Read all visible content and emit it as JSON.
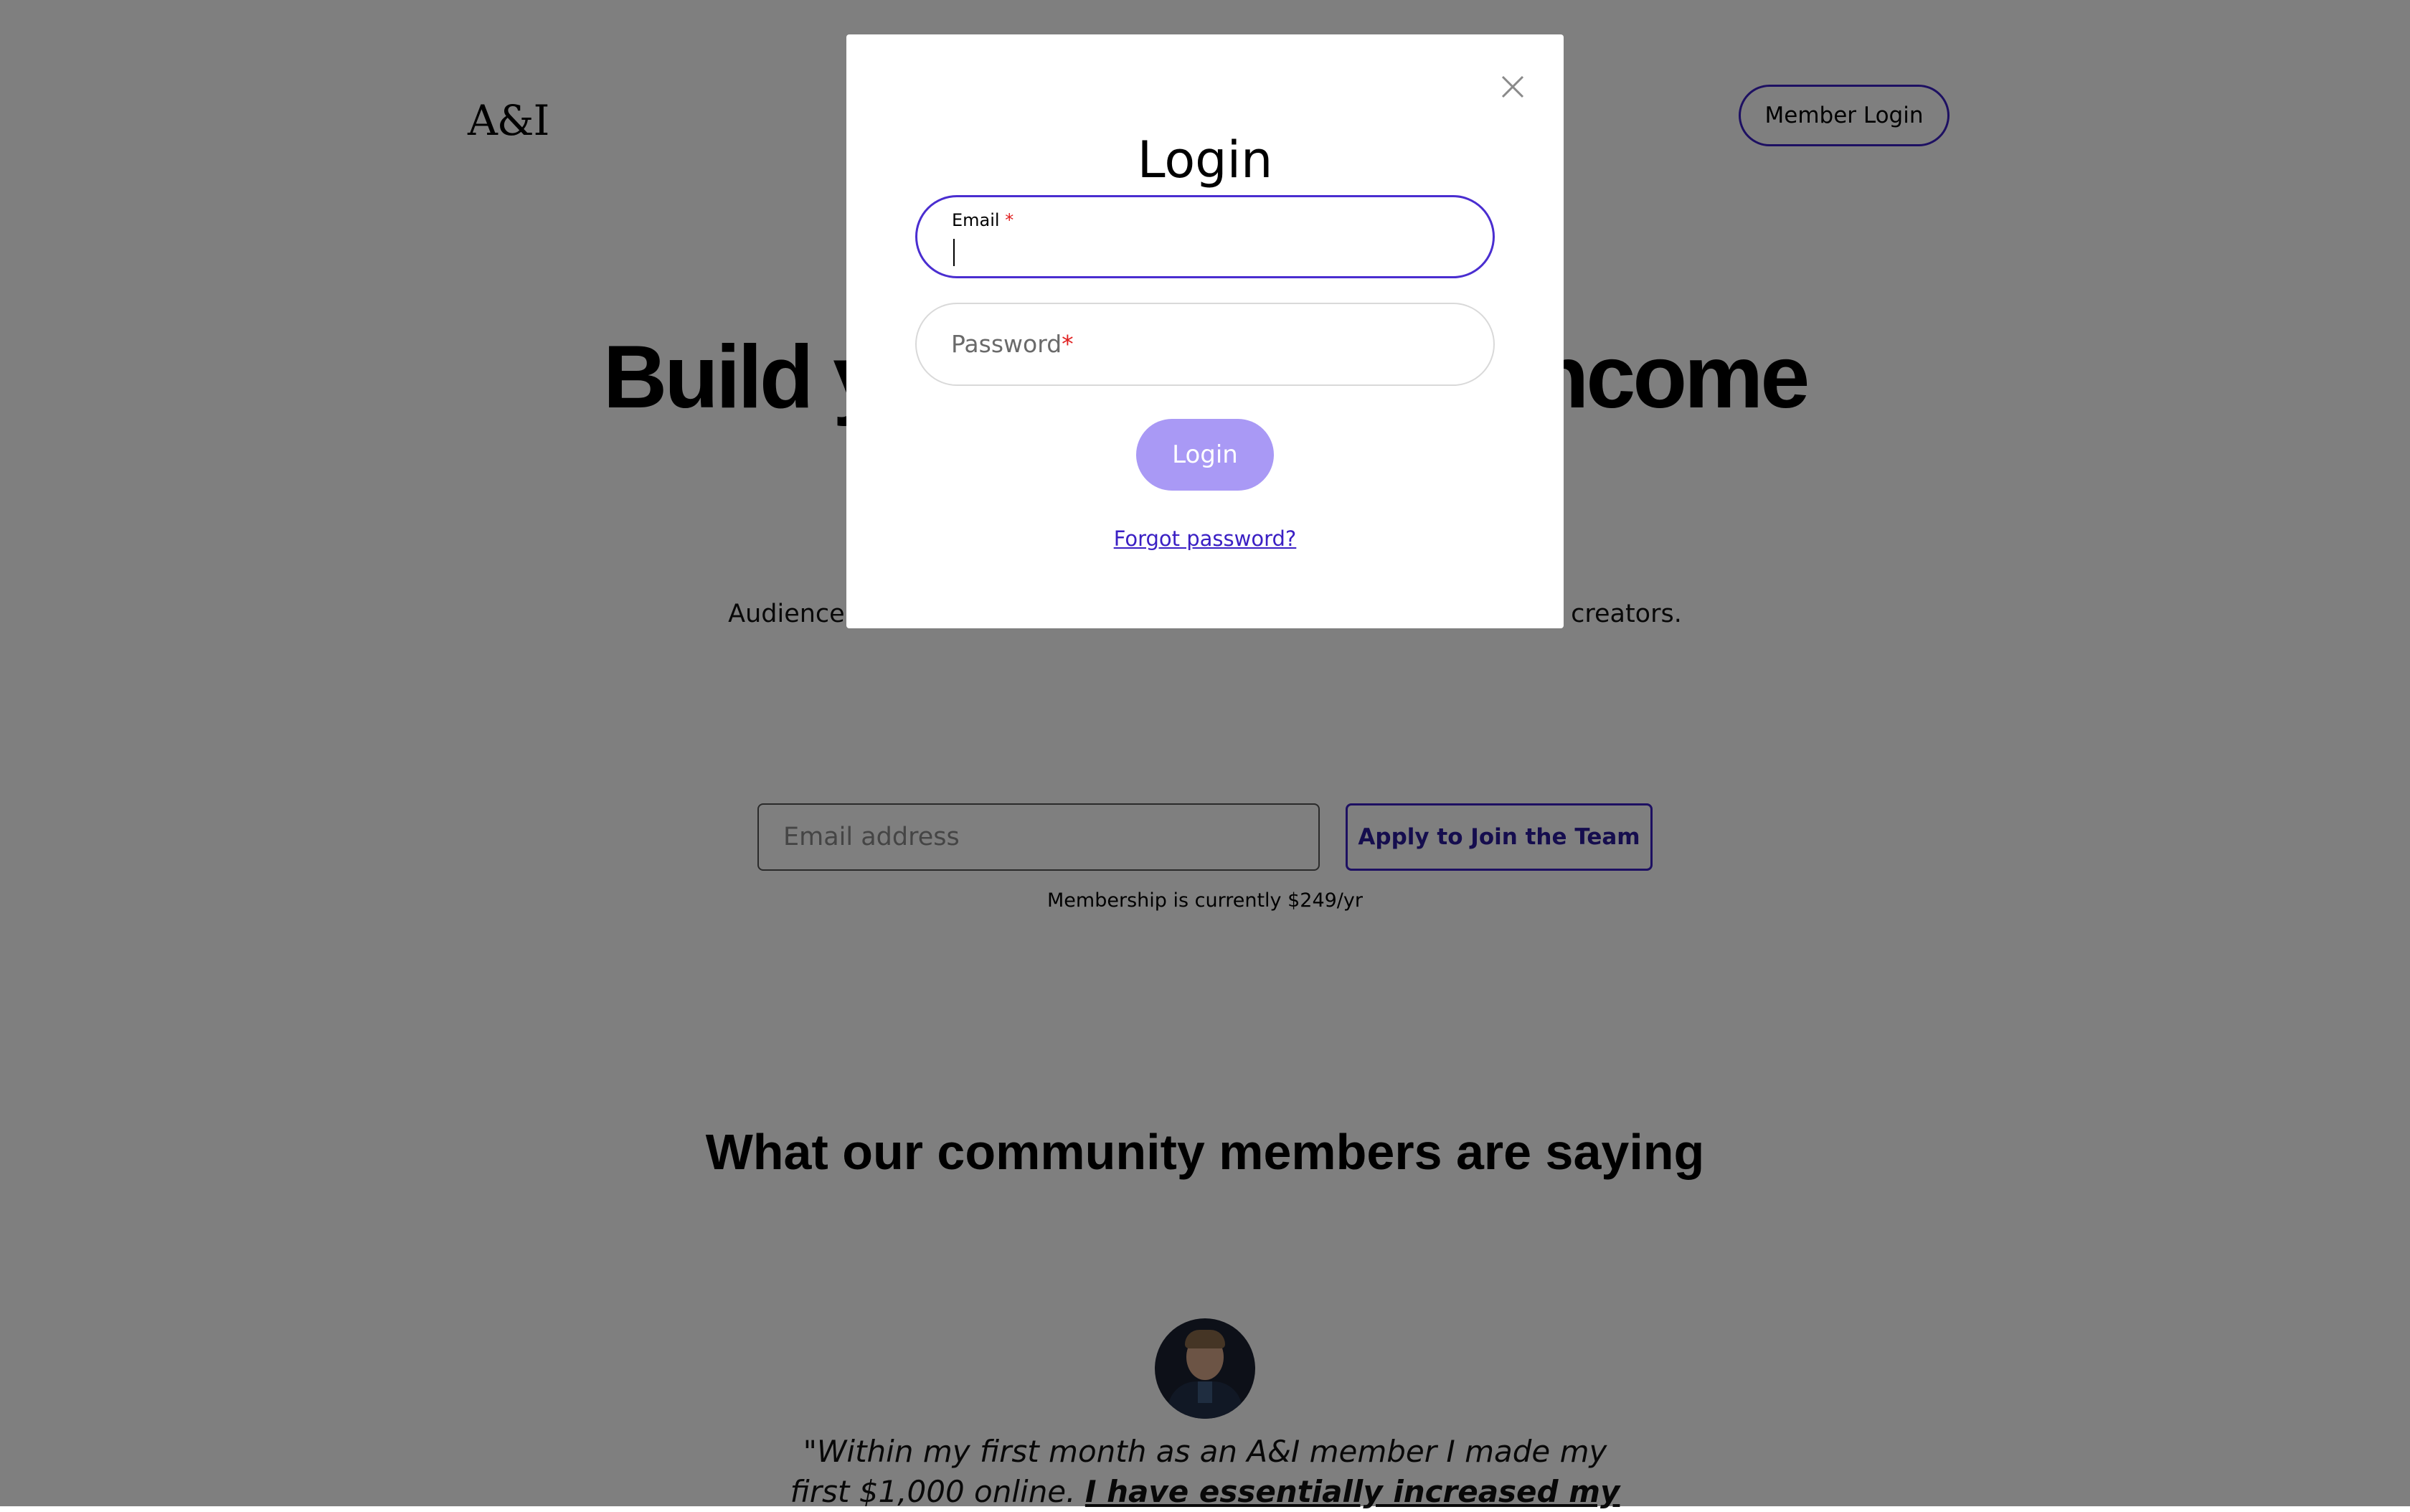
{
  "header": {
    "logo": "A&I",
    "member_login_label": "Member Login"
  },
  "hero": {
    "title_visible": "Build y                              ncome",
    "subtitle_visible": "Audience                                                                                           creators."
  },
  "signup": {
    "email_placeholder": "Email address",
    "apply_label": "Apply to Join the Team",
    "membership_note": "Membership is currently $249/yr"
  },
  "testimonials": {
    "section_title": "What our community members are saying",
    "quote_text": "\"Within my first month as an A&I member I made my first $1,000 online. ",
    "quote_bold": "I have essentially increased my"
  },
  "modal": {
    "title": "Login",
    "email_label": "Email",
    "required_mark": "*",
    "email_value": "",
    "password_placeholder": "Password",
    "login_button_label": "Login",
    "forgot_password_label": "Forgot password?",
    "close_icon": "close-icon",
    "overlay_color": "#000000",
    "accent_color": "#4a2ed0",
    "button_color": "#a999f5"
  }
}
